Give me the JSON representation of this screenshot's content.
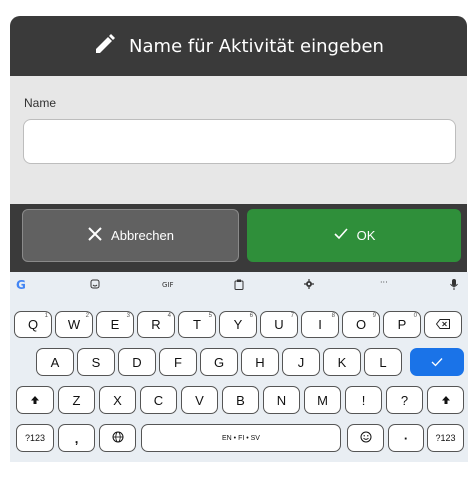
{
  "dialog": {
    "title": "Name für Aktivität eingeben",
    "field_label": "Name",
    "name_value": "",
    "cancel_label": "Abbrechen",
    "ok_label": "OK"
  },
  "colors": {
    "header_bg": "#3a3a3a",
    "panel_bg": "#e7e7e7",
    "cancel_bg": "#616161",
    "ok_bg": "#2f8f3a",
    "keyboard_bg": "#e9eef3",
    "enter_key": "#1a73e8"
  },
  "keyboard": {
    "toolbar": {
      "google": "G",
      "gif": "GIF",
      "more": "···"
    },
    "row1": [
      {
        "label": "Q",
        "hint": "1"
      },
      {
        "label": "W",
        "hint": "2"
      },
      {
        "label": "E",
        "hint": "3"
      },
      {
        "label": "R",
        "hint": "4"
      },
      {
        "label": "T",
        "hint": "5"
      },
      {
        "label": "Y",
        "hint": "6"
      },
      {
        "label": "U",
        "hint": "7"
      },
      {
        "label": "I",
        "hint": "8"
      },
      {
        "label": "O",
        "hint": "9"
      },
      {
        "label": "P",
        "hint": "0"
      }
    ],
    "row2": [
      "A",
      "S",
      "D",
      "F",
      "G",
      "H",
      "J",
      "K",
      "L"
    ],
    "row3": [
      "Z",
      "X",
      "C",
      "V",
      "B",
      "N",
      "M",
      "!",
      "?"
    ],
    "row4": {
      "symbols": "?123",
      "comma": ",",
      "space": "EN • FI • SV",
      "period": "·",
      "symbols_right": "?123"
    },
    "icons": [
      "google-icon",
      "sticker-icon",
      "gif-icon",
      "clipboard-icon",
      "settings-icon",
      "more-icon",
      "mic-icon",
      "backspace-icon",
      "enter-check-icon",
      "shift-icon",
      "globe-icon",
      "emoji-icon"
    ]
  }
}
